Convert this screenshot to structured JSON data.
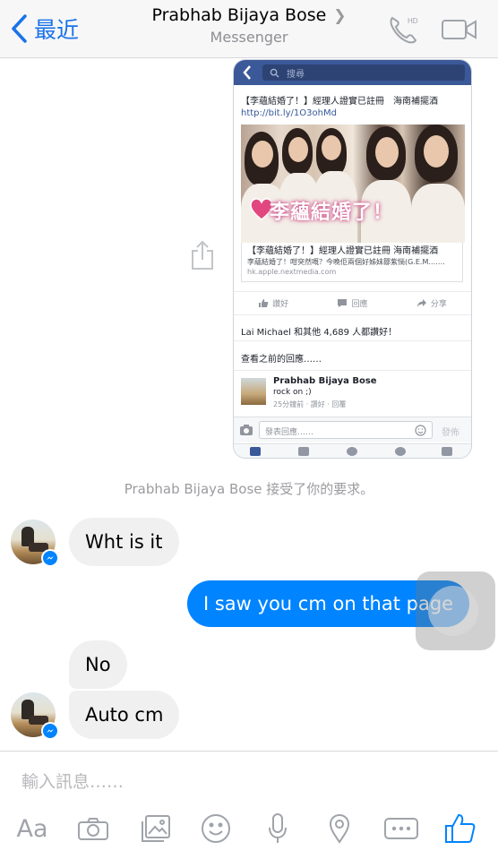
{
  "nav": {
    "back_label": "最近",
    "contact_name": "Prabhab Bijaya Bose",
    "subtitle": "Messenger",
    "call_badge": "HD"
  },
  "shared_card": {
    "search_placeholder": "搜尋",
    "post_title": "【李蘊結婚了！】經理人證實已註冊　海南補擺酒",
    "post_link": "http://bit.ly/1O3ohMd",
    "photo_caption": "李蘊結婚了！",
    "link_title": "【李蘊結婚了！】經理人證實已註冊 海南補擺酒",
    "link_desc": "李蘊結婚了！咁突然嘅？今晚佢兩個好姊妹鄒紫惝(G.E.M.……",
    "link_domain": "hk.apple.nextmedia.com",
    "action_like": "讚好",
    "action_comment": "回應",
    "action_share": "分享",
    "likes_text": "Lai Michael 和其他 4,689 人都讚好！",
    "prev_comments": "查看之前的回應……",
    "comment_author": "Prabhab Bijaya Bose",
    "comment_text": "rock on ;)",
    "comment_meta": "25分鐘前 · 讚好 · 回覆",
    "comment_placeholder": "發表回應……",
    "comment_post": "發佈"
  },
  "system_message": "Prabhab Bijaya Bose 接受了你的要求。",
  "messages": [
    {
      "from": "them",
      "text": "Wht is it"
    },
    {
      "from": "me",
      "text": "I saw you cm on that page"
    },
    {
      "from": "them",
      "text": "No"
    },
    {
      "from": "them",
      "text": "Auto cm"
    }
  ],
  "composer": {
    "placeholder": "輸入訊息……",
    "aa_label": "Aa"
  },
  "colors": {
    "accent": "#0084ff",
    "ios_blue": "#1a73e8",
    "incoming_bubble": "#f1f0f0",
    "facebook_blue": "#3b5998"
  },
  "icons": [
    "chevron-left-icon",
    "phone-hd-icon",
    "video-icon",
    "share-icon",
    "camera-icon",
    "image-icon",
    "emoji-icon",
    "microphone-icon",
    "location-icon",
    "more-icon",
    "thumbs-up-icon"
  ]
}
